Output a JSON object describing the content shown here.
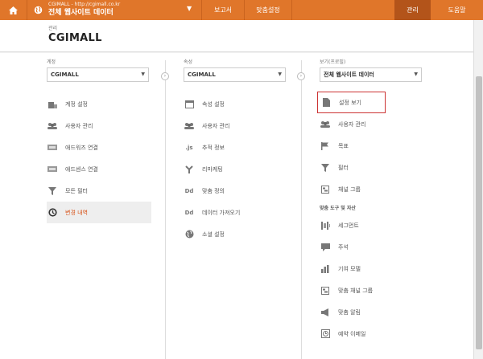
{
  "topbar": {
    "account_line1": "CGIMALL - http://cgimall.co.kr",
    "account_line2": "전체 웹사이트 데이터",
    "nav": [
      "보고서",
      "맞춤설정",
      "관리",
      "도움말"
    ],
    "accent_color": "#e0762a",
    "active_color": "#b3541a"
  },
  "header": {
    "subtitle": "관리",
    "title": "CGIMALL"
  },
  "account_col": {
    "label": "계정",
    "selected": "CGIMALL",
    "items": [
      {
        "label": "계정 설정",
        "icon": "building-icon"
      },
      {
        "label": "사용자 관리",
        "icon": "users-icon"
      },
      {
        "label": "애드워즈 연결",
        "icon": "link-panel-icon"
      },
      {
        "label": "애드센스 연결",
        "icon": "link-panel-icon"
      },
      {
        "label": "모든 필터",
        "icon": "filter-icon"
      },
      {
        "label": "변경 내역",
        "icon": "history-icon"
      }
    ]
  },
  "property_col": {
    "label": "속성",
    "selected": "CGIMALL",
    "items": [
      {
        "label": "속성 설정",
        "icon": "window-icon"
      },
      {
        "label": "사용자 관리",
        "icon": "users-icon"
      },
      {
        "label": "추적 정보",
        "icon": "js-icon"
      },
      {
        "label": "리마케팅",
        "icon": "fork-icon"
      },
      {
        "label": "맞춤 정의",
        "icon": "dd-icon"
      },
      {
        "label": "데이터 가져오기",
        "icon": "dd-icon"
      },
      {
        "label": "소셜 설정",
        "icon": "globe-icon"
      }
    ]
  },
  "view_col": {
    "label": "보기(프로필)",
    "selected": "전체 웹사이트 데이터",
    "items": [
      {
        "label": "설정 보기",
        "icon": "doc-icon"
      },
      {
        "label": "사용자 관리",
        "icon": "users-icon"
      },
      {
        "label": "목표",
        "icon": "flag-icon"
      },
      {
        "label": "필터",
        "icon": "filter-icon"
      },
      {
        "label": "채널 그룹",
        "icon": "channel-icon"
      }
    ],
    "section_label": "맞춤 도구 및 자산",
    "tools": [
      {
        "label": "세그먼트",
        "icon": "segment-icon"
      },
      {
        "label": "주석",
        "icon": "note-icon"
      },
      {
        "label": "기여 모델",
        "icon": "bars-icon"
      },
      {
        "label": "맞춤 채널 그룹",
        "icon": "channel-icon"
      },
      {
        "label": "맞춤 알림",
        "icon": "megaphone-icon"
      },
      {
        "label": "예약 이메일",
        "icon": "clock-icon"
      }
    ]
  }
}
